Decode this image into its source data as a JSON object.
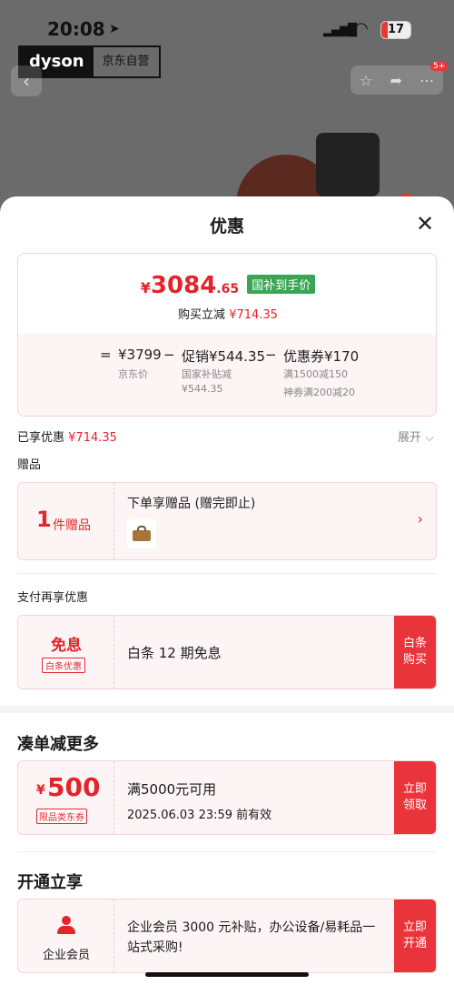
{
  "status": {
    "time": "20:08",
    "battery": "17"
  },
  "header": {
    "brand_logo": "dyson",
    "brand_tag": "京东自营",
    "cart_badge": "5+"
  },
  "sheet": {
    "title": "优惠"
  },
  "price": {
    "currency": "¥",
    "integer": "3084",
    "decimal": ".65",
    "tag": "国补到手价",
    "buy_label": "购买立减",
    "buy_amount": "¥714.35",
    "eq": "=",
    "base": "¥3799",
    "base_label": "京东价",
    "minus1": "−",
    "promo": "促销¥544.35",
    "promo_sub1": "国家补贴减",
    "promo_sub2": "¥544.35",
    "minus2": "−",
    "coupon": "优惠券¥170",
    "coupon_sub1": "满1500减150",
    "coupon_sub2": "神券满200减20"
  },
  "saved": {
    "label": "已享优惠",
    "amount": "¥714.35",
    "expand": "展开 ⌵"
  },
  "gift": {
    "section": "赠品",
    "count": "1",
    "count_unit": "件赠品",
    "title": "下单享赠品 (赠完即止)"
  },
  "pay": {
    "section": "支付再享优惠",
    "left_title": "免息",
    "left_tag": "白条优惠",
    "text": "白条 12 期免息",
    "button": "白条购买"
  },
  "more": {
    "section": "凑单减更多",
    "currency": "¥",
    "amount": "500",
    "tag": "限品类东券",
    "title": "满5000元可用",
    "validity": "2025.06.03 23:59 前有效",
    "button": "立即领取"
  },
  "open": {
    "section": "开通立享",
    "left_label": "企业会员",
    "text": "企业会员 3000 元补贴，办公设备/易耗品一站式采购!",
    "button": "立即开通"
  },
  "colors": {
    "accent": "#e8343a",
    "green_tag": "#3aa655"
  }
}
